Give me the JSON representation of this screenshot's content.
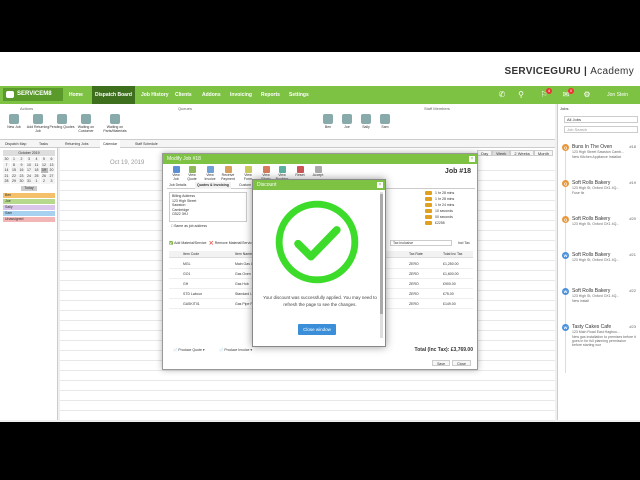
{
  "brand": {
    "name": "SERVICEGURU",
    "suffix": "Academy"
  },
  "nav": {
    "logo": "SERVICEM8",
    "items": [
      "Home",
      "Dispatch Board",
      "Job History",
      "Clients",
      "Addons",
      "Invoicing",
      "Reports",
      "Settings"
    ],
    "active_index": 1,
    "user": "Jon Stein",
    "badges": [
      "4",
      "0"
    ]
  },
  "toolbar": {
    "groups": [
      "Actions",
      "Queues",
      "Staff Members"
    ],
    "buttons": [
      "New Job",
      "Add Returning Job",
      "Pending Quotes",
      "Waiting on Customer",
      "Waiting on Parts/Materials"
    ],
    "staff": [
      "Ben",
      "Joe",
      "Sally",
      "Sam"
    ]
  },
  "subtabs": [
    "Dispatch Map",
    "Tasks",
    "Returning Jobs",
    "Calendar",
    "Staff Schedule"
  ],
  "subtabs_active": 3,
  "leftpanel": {
    "month": "October 2019",
    "days": [
      "30",
      "1",
      "2",
      "3",
      "4",
      "5",
      "6",
      "7",
      "8",
      "9",
      "10",
      "11",
      "12",
      "13",
      "14",
      "15",
      "16",
      "17",
      "18",
      "19",
      "20",
      "21",
      "22",
      "23",
      "24",
      "25",
      "26",
      "27",
      "28",
      "29",
      "30",
      "31",
      "1",
      "2",
      "3"
    ],
    "today_label": "Today",
    "staff": [
      {
        "name": "Ben",
        "color": "#f4c06a"
      },
      {
        "name": "Joe",
        "color": "#b7d98d"
      },
      {
        "name": "Sally",
        "color": "#d9c6ea"
      },
      {
        "name": "Sam",
        "color": "#a8d0ef"
      },
      {
        "name": "Unassigned",
        "color": "#f3b6b6"
      }
    ]
  },
  "calendar": {
    "date": "Oct 19, 2019",
    "views": [
      "Day",
      "Week",
      "2 Weeks",
      "Month"
    ],
    "active_view": 1,
    "day_header": "Sat 19"
  },
  "jobs": {
    "title": "Jobs",
    "filter": "All Jobs",
    "search_placeholder": "Job Search",
    "items": [
      {
        "name": "Buns In The Oven",
        "num": "#18",
        "addr": "123 High Street Sawston Camb...",
        "note": "New Kitchen Appliance Installat",
        "color": "#e8963a",
        "letter": "Q"
      },
      {
        "name": "Soft Rolls Bakery",
        "num": "#19",
        "addr": "123 High St, Oxford OX1 4Q...",
        "note": "Fuse fix",
        "color": "#e8963a",
        "letter": "Q"
      },
      {
        "name": "Soft Rolls Bakery",
        "num": "#20",
        "addr": "123 High St, Oxford OX1 4Q...",
        "note": "",
        "color": "#e8963a",
        "letter": "Q"
      },
      {
        "name": "Soft Rolls Bakery",
        "num": "#21",
        "addr": "123 High St, Oxford OX1 4Q...",
        "note": "",
        "color": "#4a90d9",
        "letter": "W"
      },
      {
        "name": "Soft Rolls Bakery",
        "num": "#22",
        "addr": "123 High St, Oxford OX1 4Q...",
        "note": "New install",
        "color": "#4a90d9",
        "letter": "W"
      },
      {
        "name": "Tasty Cakes Cafe",
        "num": "#23",
        "addr": "123 Main Road East Hagbou...",
        "note": "New gas installation to premises before it goes in for full planning permission before starting wor",
        "color": "#4a90d9",
        "letter": "W"
      }
    ]
  },
  "modal": {
    "title": "Modify Job #18",
    "job_no": "Job #18",
    "tools": [
      "View Job",
      "View Quote",
      "View Invoice",
      "Receive Payment",
      "View Form",
      "View Photo",
      "View Booking",
      "Reset",
      "Accept"
    ],
    "tabs": [
      "Job Details",
      "Quotes & Invoicing",
      "Custom Fields"
    ],
    "active_tab": 1,
    "address_label": "Billing Address",
    "address": [
      "123 High Street",
      "Sawston",
      "Cambridge",
      "CB22 3HJ"
    ],
    "same_as": "Same as job address",
    "add_material": "Add Material/Service",
    "remove_material": "Remove Material/Service",
    "tax_select": "Tax Inclusive",
    "incl_tax": "Incl Tax",
    "right_info": [
      "1 hr 28 mins",
      "1 hr 28 mins",
      "1 hr 24 mins",
      "10 seconds",
      "00 seconds",
      "£2255"
    ],
    "columns": [
      "Item Code",
      "Item Name",
      "Tax Rate",
      "Total Inc Tax"
    ],
    "rows": [
      {
        "code": "MGL",
        "name": "Main Gas Line",
        "tax": "ZERO",
        "total": "£1,250.00"
      },
      {
        "code": "GO1",
        "name": "Gas Oven",
        "tax": "ZERO",
        "total": "£1,600.00"
      },
      {
        "code": "GH",
        "name": "Gas Hob",
        "tax": "ZERO",
        "total": "£900.00"
      },
      {
        "code": "STD Labour",
        "name": "Standard Lab",
        "tax": "ZERO",
        "total": "£75.00"
      },
      {
        "code": "GASKIT01",
        "name": "Gas Pipe Pack",
        "tax": "ZERO",
        "total": "£149.00"
      }
    ],
    "produce_quote": "Produce Quote",
    "produce_invoice": "Produce Invoice",
    "total": "Total (Inc Tax): £3,769.00",
    "footer": [
      "Save",
      "Close"
    ]
  },
  "dialog": {
    "title": "Discount",
    "message": "Your discount was successfully applied. You may need to refresh the page to see the changes.",
    "button": "Close window",
    "check_color": "#3ddc2b"
  }
}
